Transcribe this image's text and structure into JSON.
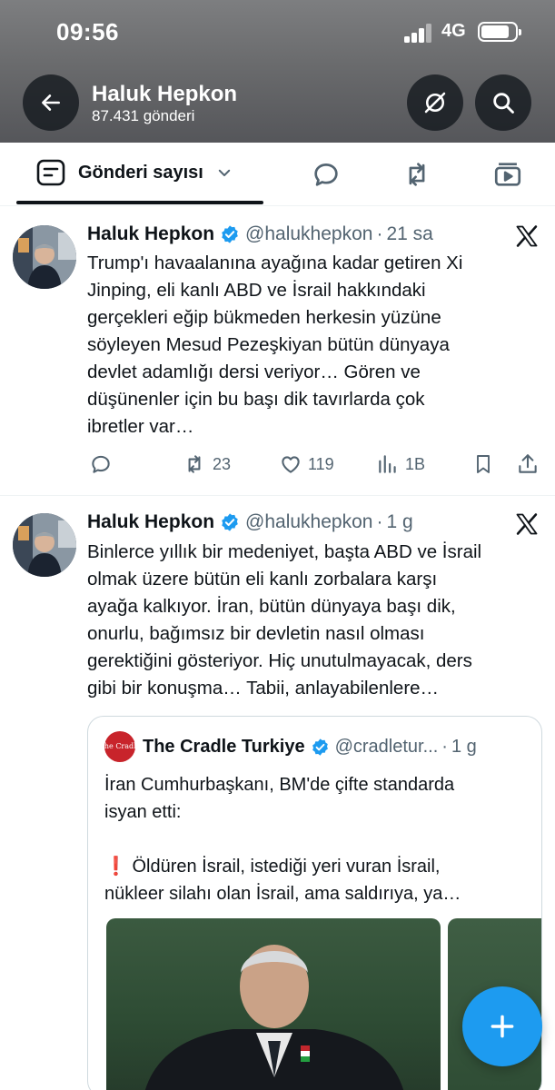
{
  "status_bar": {
    "time": "09:56",
    "network": "4G"
  },
  "header": {
    "profile_name": "Haluk Hepkon",
    "post_count": "87.431 gönderi"
  },
  "tabs": {
    "filter_label": "Gönderi sayısı"
  },
  "tweets": [
    {
      "name": "Haluk Hepkon",
      "handle": "@halukhepkon",
      "separator": "·",
      "time": "21 sa",
      "lines": [
        "Trump'ı havaalanına ayağına kadar getiren Xi",
        "Jinping, eli kanlı ABD ve İsrail hakkındaki",
        "gerçekleri eğip bükmeden herkesin yüzüne",
        "söyleyen Mesud Pezeşkiyan bütün dünyaya",
        "devlet adamlığı dersi veriyor… Gören ve",
        "düşünenler için bu başı dik tavırlarda çok",
        "ibretler var…"
      ],
      "retweets": "23",
      "likes": "119",
      "views": "1B"
    },
    {
      "name": "Haluk Hepkon",
      "handle": "@halukhepkon",
      "separator": "·",
      "time": "1 g",
      "lines": [
        "Binlerce yıllık bir medeniyet, başta ABD ve İsrail",
        "olmak üzere bütün eli kanlı zorbalara karşı",
        "ayağa kalkıyor. İran, bütün dünyaya başı dik,",
        "onurlu, bağımsız bir devletin nasıl olması",
        "gerektiğini gösteriyor. Hiç unutulmayacak, ders",
        "gibi bir konuşma… Tabii, anlayabilenlere…"
      ],
      "quote": {
        "name": "The Cradle Turkiye",
        "handle": "@cradletur...",
        "separator": "·",
        "time": "1 g",
        "logo_text": "The Cradle",
        "lines": [
          "İran Cumhurbaşkanı, BM'de çifte standarda",
          "isyan etti:",
          "",
          "❗ Öldüren İsrail, istediği yeri vuran İsrail,",
          "nükleer silahı olan İsrail, ama saldırıya, ya…"
        ]
      }
    }
  ],
  "colors": {
    "accent": "#1d9bf0",
    "text": "#0f1419",
    "muted": "#536471",
    "border": "#eff3f4"
  },
  "icons": {
    "back": "arrow-left-icon",
    "notifications_off": "bell-off-icon",
    "search": "search-icon",
    "filter": "filter-icon",
    "replies_tab": "reply-icon",
    "reposts_tab": "retweet-icon",
    "media_tab": "media-icon",
    "compose": "plus-icon"
  }
}
